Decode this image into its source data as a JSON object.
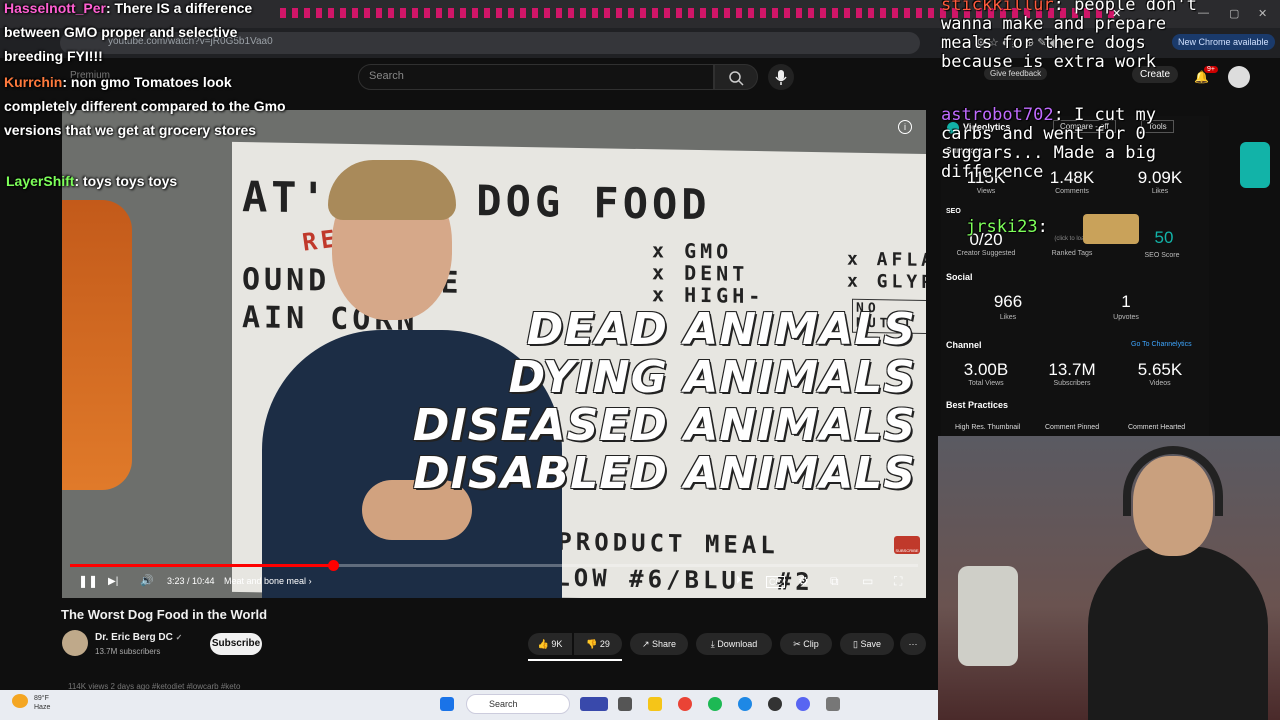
{
  "browser": {
    "url": "youtube.com/watch?v=jR0G5b1Vaa0",
    "chrome_available": "New Chrome available"
  },
  "youtube": {
    "premium_label": "Premium",
    "search_placeholder": "Search",
    "give_feedback": "Give feedback",
    "create_label": "Create",
    "notif_count": "9+"
  },
  "video": {
    "whiteboard": {
      "heading": "AT'S   IN DOG FOOD",
      "really": "REALLY",
      "line1": "OUND WHOLE",
      "line2": "AIN CORN",
      "gmo_list": "x GMO\nx DENT\nx HIGH-",
      "right_list": "x AFLATO\nx GLYPHO",
      "no_nutri": "NO NUTRI",
      "byproduct": "BY-PRODUCT MEAL",
      "yellow": "YELLOW #6/BLUE #2"
    },
    "overlay_lines": [
      "DEAD ANIMALS",
      "DYING ANIMALS",
      "DISEASED ANIMALS",
      "DISABLED ANIMALS"
    ],
    "subscribe_watermark": "SUBSCRIBE",
    "progress_fraction": 0.31,
    "time": "3:23 / 10:44",
    "chapter": "Meat and bone meal",
    "chapter_chevron": "›",
    "icons": {
      "pause": "❚❚",
      "next": "▶|",
      "volume": "🔊",
      "autoplay": "⏵",
      "cc": "CC",
      "settings": "⚙",
      "miniplayer": "⧉",
      "theater": "▭",
      "fullscreen": "⛶",
      "info": "i"
    }
  },
  "details": {
    "title": "The Worst Dog Food in the World",
    "channel": "Dr. Eric Berg DC",
    "verified": "✓",
    "subscribers": "13.7M subscribers",
    "subscribe_label": "Subscribe",
    "likes": "9K",
    "dislikes": "29",
    "share": "Share",
    "download": "Download",
    "clip": "Clip",
    "save": "Save",
    "more": "···",
    "description_peek": "114K views  2 days ago  #ketodiet #lowcarb #keto"
  },
  "taskbar": {
    "temp": "89°F",
    "weather": "Haze",
    "search": "Search"
  },
  "chat": [
    {
      "name": "Hasselnott_Per",
      "name_color": "#ff5fd2",
      "text": ": There IS a difference between GMO proper and selective breeding FYI!!!"
    },
    {
      "name": "Kurrchin",
      "name_color": "#ff7a3d",
      "text": ": non gmo Tomatoes look completely different compared to the Gmo versions that we get at grocery stores"
    },
    {
      "name": "LayerShift",
      "name_color": "#7dff5a",
      "text": ": toys toys toys"
    }
  ],
  "right_chat": [
    {
      "name": "stickkillur",
      "name_color": "#ff5a3d",
      "text": ": people don't wanna make and prepare meals for there dogs because is extra work"
    },
    {
      "name": "astrobot702",
      "name_color": "#c06bff",
      "text": ": I cut my carbs and went for 0 suggars... Made a big difference"
    },
    {
      "name": "jrski23",
      "name_color": "#7dff5a",
      "text": ":"
    }
  ],
  "videolytics": {
    "title": "Videolytics",
    "compare": "Compare - off",
    "tools": "Tools",
    "summary_label": "Summary",
    "views": "115K",
    "views_label": "Views",
    "comments": "1.48K",
    "comments_label": "Comments",
    "likes": "9.09K",
    "likes_label": "Likes",
    "seo_label": "SEO",
    "tags": "0/20",
    "tags_label": "Creator Suggested",
    "ranked_tags": "Ranked Tags",
    "click_hint": "(click to load)",
    "seo_score": "50",
    "seo_score_label": "SEO Score",
    "social_label": "Social",
    "social_likes": "966",
    "social_likes_label": "Likes",
    "upvotes": "1",
    "upvotes_label": "Upvotes",
    "channel_label": "Channel",
    "go_channel": "Go To Channelytics",
    "total_views": "3.00B",
    "total_views_label": "Total Views",
    "ch_subs": "13.7M",
    "ch_subs_label": "Subscribers",
    "ch_videos": "5.65K",
    "ch_videos_label": "Videos",
    "best_practices": "Best Practices",
    "bp1": "High Res. Thumbnail",
    "bp2": "Comment Pinned",
    "bp3": "Comment Hearted"
  },
  "colors": {
    "progress": "#ff0000",
    "accent_teal": "#12b3a8",
    "link_blue": "#3ea6ff"
  }
}
